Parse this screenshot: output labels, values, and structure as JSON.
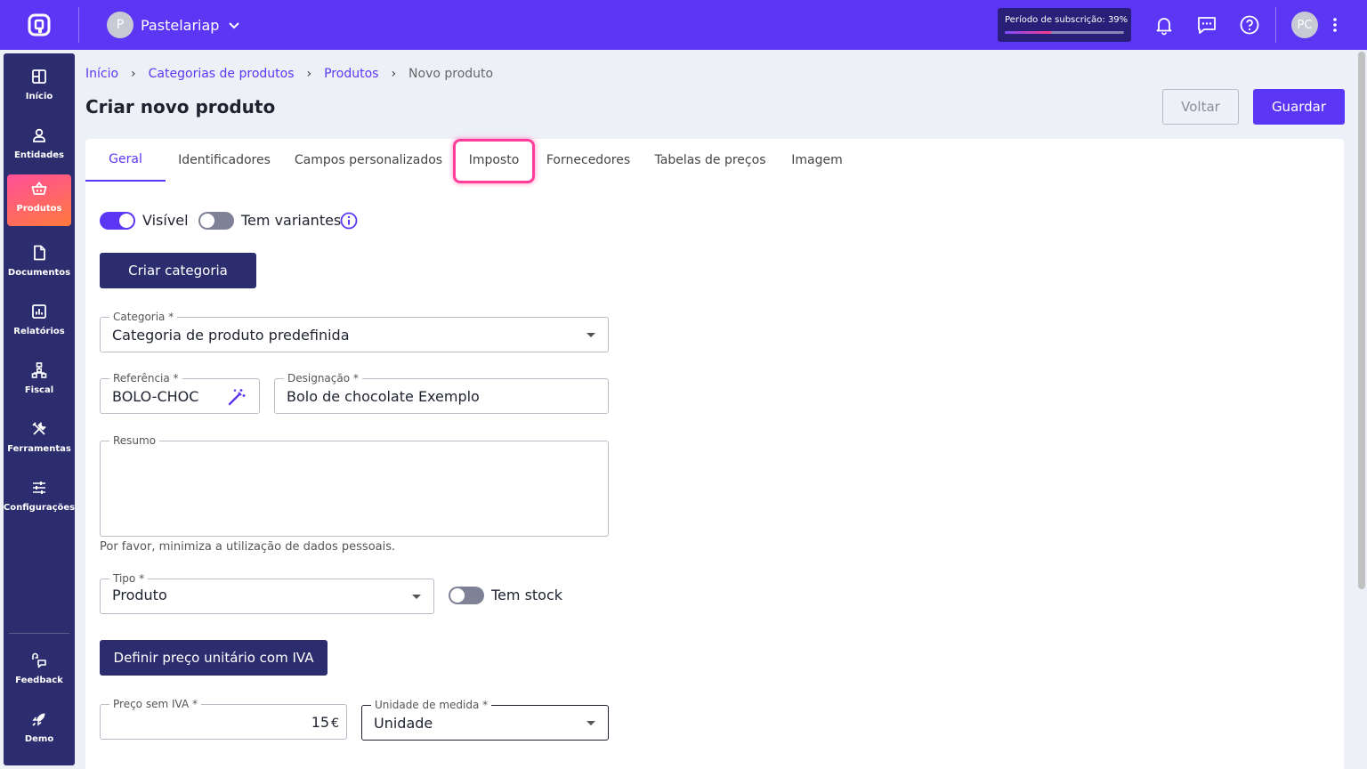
{
  "topbar": {
    "company_initial": "P",
    "company_name": "Pastelariap",
    "subscription_label": "Período de subscrição: 39%",
    "subscription_progress": 0.39,
    "user_initials": "PC"
  },
  "sidebar": {
    "items": [
      {
        "label": "Início",
        "icon": "dashboard-icon"
      },
      {
        "label": "Entidades",
        "icon": "person-icon"
      },
      {
        "label": "Produtos",
        "icon": "basket-icon"
      },
      {
        "label": "Documentos",
        "icon": "document-icon"
      },
      {
        "label": "Relatórios",
        "icon": "chart-icon"
      },
      {
        "label": "Fiscal",
        "icon": "hierarchy-icon"
      },
      {
        "label": "Ferramentas",
        "icon": "tools-icon"
      },
      {
        "label": "Configurações",
        "icon": "sliders-icon"
      }
    ],
    "bottom": [
      {
        "label": "Feedback",
        "icon": "feedback-icon"
      },
      {
        "label": "Demo",
        "icon": "rocket-icon"
      }
    ]
  },
  "breadcrumb": {
    "items": [
      "Início",
      "Categorias de produtos",
      "Produtos"
    ],
    "current": "Novo produto"
  },
  "page": {
    "title": "Criar novo produto",
    "back_label": "Voltar",
    "save_label": "Guardar"
  },
  "tabs": [
    "Geral",
    "Identificadores",
    "Campos personalizados",
    "Imposto",
    "Fornecedores",
    "Tabelas de preços",
    "Imagem"
  ],
  "form": {
    "visible_label": "Visível",
    "variants_label": "Tem variantes",
    "create_category_label": "Criar categoria",
    "category_label": "Categoria *",
    "category_value": "Categoria de produto predefinida",
    "reference_label": "Referência *",
    "reference_value": "BOLO-CHOC",
    "designation_label": "Designação *",
    "designation_value": "Bolo de chocolate Exemplo",
    "summary_label": "Resumo",
    "summary_hint": "Por favor, minimiza a utilização de dados pessoais.",
    "type_label": "Tipo *",
    "type_value": "Produto",
    "stock_label": "Tem stock",
    "set_price_label": "Definir preço unitário com IVA",
    "price_label": "Preço sem IVA *",
    "price_value": "15",
    "price_currency": "€",
    "unit_label": "Unidade de medida *",
    "unit_value": "Unidade"
  },
  "colors": {
    "brand": "#5b36f5",
    "sidebar": "#2b2d6e",
    "active_gradient_start": "#ff4f9a",
    "active_gradient_end": "#ff7a3d",
    "highlight": "#ff3d9a"
  }
}
